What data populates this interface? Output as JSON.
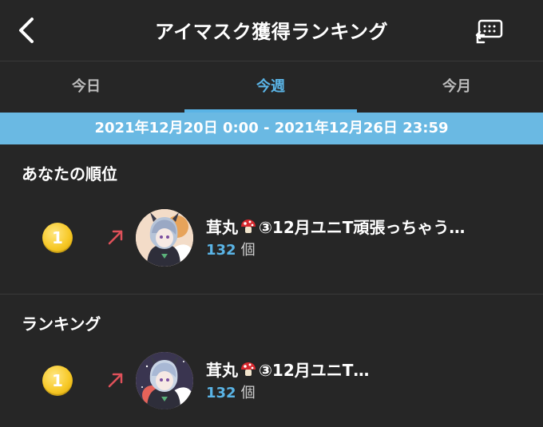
{
  "header": {
    "title": "アイマスク獲得ランキング",
    "back_icon": "chevron-left-icon",
    "share_icon": "share-icon"
  },
  "tabs": [
    {
      "label": "今日",
      "active": false
    },
    {
      "label": "今週",
      "active": true
    },
    {
      "label": "今月",
      "active": false
    }
  ],
  "period": "2021年12月20日 0:00 - 2021年12月26日 23:59",
  "my_rank": {
    "section_title": "あなたの順位",
    "rank": "1",
    "name_prefix": "茸丸",
    "name_suffix": "③12月ユニT頑張っちゃう…",
    "count": "132",
    "unit": "個",
    "trend": "up"
  },
  "ranking": {
    "section_title": "ランキング",
    "items": [
      {
        "rank": "1",
        "name_prefix": "茸丸",
        "name_suffix": "③12月ユニT…",
        "count": "132",
        "unit": "個",
        "trend": "up"
      }
    ]
  },
  "colors": {
    "accent": "#5ab4e6",
    "period_bar": "#6ab9e3",
    "trend_up": "#e0515a",
    "background": "#262626"
  }
}
